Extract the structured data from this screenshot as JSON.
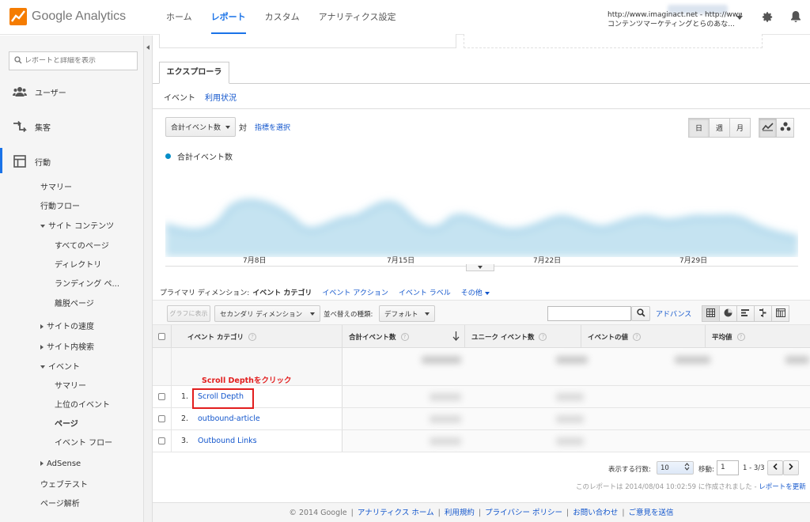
{
  "header": {
    "logo_text": "Google Analytics",
    "nav": [
      "ホーム",
      "レポート",
      "カスタム",
      "アナリティクス設定"
    ],
    "active_nav_index": 1,
    "account_line1": "http://www.imaginact.net - http://www.i...",
    "account_line2": "コンテンツマーケティングとらのあな..."
  },
  "sidebar": {
    "search_placeholder": "レポートと詳細を表示",
    "sections": {
      "users": "ユーザー",
      "acquisition": "集客",
      "behavior": "行動"
    },
    "behavior_items": {
      "summary": "サマリー",
      "flow": "行動フロー",
      "site_content": "サイト コンテンツ",
      "all_pages": "すべてのページ",
      "directory": "ディレクトリ",
      "landing": "ランディング ペ...",
      "exit": "離脱ページ",
      "site_speed": "サイトの速度",
      "site_search": "サイト内検索",
      "events": "イベント",
      "events_summary": "サマリー",
      "top_events": "上位のイベント",
      "pages": "ページ",
      "event_flow": "イベント フロー",
      "adsense": "AdSense",
      "web_test": "ウェブテスト",
      "page_analytics": "ページ解析"
    }
  },
  "explorer": {
    "tab": "エクスプローラ",
    "subtabs": [
      "イベント",
      "利用状況"
    ],
    "metric_select": "合計イベント数",
    "vs": "対",
    "select_metric": "指標を選択",
    "granularity": [
      "日",
      "週",
      "月"
    ],
    "active_granularity": 0
  },
  "chart_data": {
    "type": "area",
    "legend": "合計イベント数",
    "x_tick_labels": [
      "7月8日",
      "7月15日",
      "7月22日",
      "7月29日"
    ],
    "series_color": "#058dc7"
  },
  "dimensions": {
    "label": "プライマリ ディメンション:",
    "active": "イベント カテゴリ",
    "others": [
      "イベント アクション",
      "イベント ラベル"
    ],
    "more": "その他"
  },
  "table_toolbar": {
    "graph_btn": "グラフに表示",
    "secondary_dim": "セカンダリ ディメンション",
    "sort_label": "並べ替えの種類:",
    "sort_value": "デフォルト",
    "advanced": "アドバンス"
  },
  "table": {
    "columns": [
      "イベント カテゴリ",
      "合計イベント数",
      "ユニーク イベント数",
      "イベントの値",
      "平均値"
    ],
    "annotation": "Scroll Depthをクリック",
    "rows": [
      {
        "num": "1.",
        "name": "Scroll Depth"
      },
      {
        "num": "2.",
        "name": "outbound-article"
      },
      {
        "num": "3.",
        "name": "Outbound Links"
      }
    ]
  },
  "pager": {
    "rows_label": "表示する行数:",
    "rows_value": "10",
    "goto_label": "移動:",
    "goto_value": "1",
    "range": "1 - 3/3"
  },
  "created_note": "このレポートは 2014/08/04 10:02:59 に作成されました - ",
  "refresh_link": "レポートを更新",
  "footer": {
    "copyright": "© 2014 Google",
    "links": [
      "アナリティクス ホーム",
      "利用規約",
      "プライバシー ポリシー",
      "お問い合わせ",
      "ご意見を送信"
    ]
  }
}
